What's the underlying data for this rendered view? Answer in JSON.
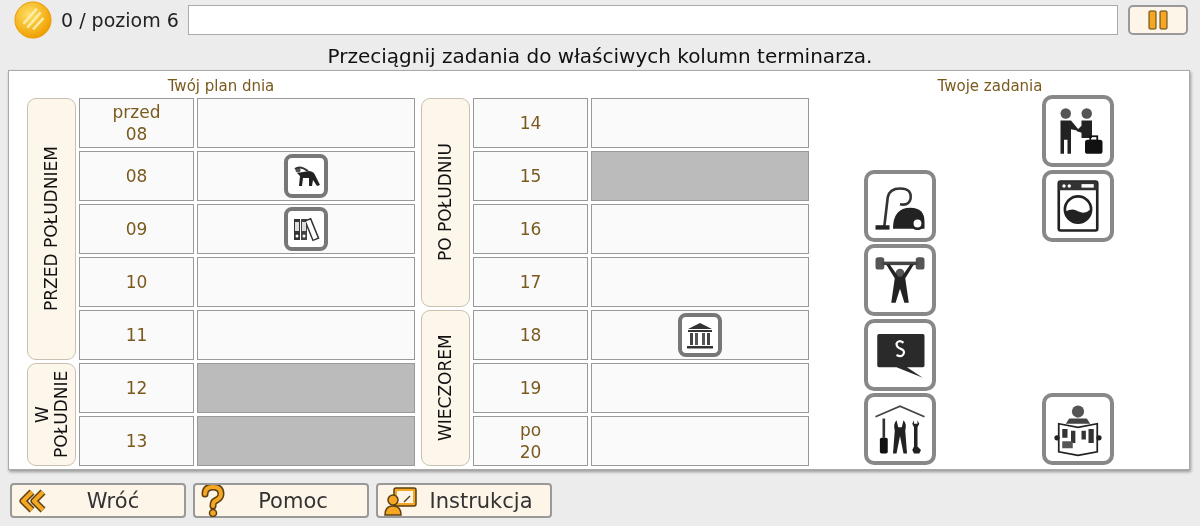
{
  "header": {
    "score": "0 / poziom 6"
  },
  "instruction": "Przeciągnij zadania do właściwych kolumn terminarza.",
  "schedule": {
    "title": "Twój plan dnia",
    "columns": [
      {
        "periods": [
          {
            "label": "PRZED POŁUDNIEM",
            "hours": [
              {
                "label": "przed\n08",
                "blocked": false
              },
              {
                "label": "08",
                "blocked": false,
                "task": {
                  "kind": "stretching"
                }
              },
              {
                "label": "09",
                "blocked": false,
                "task": {
                  "kind": "binders"
                }
              },
              {
                "label": "10",
                "blocked": false
              },
              {
                "label": "11",
                "blocked": false
              }
            ]
          },
          {
            "label": "W\nPOŁUDNIE",
            "hours": [
              {
                "label": "12",
                "blocked": true
              },
              {
                "label": "13",
                "blocked": true
              }
            ]
          }
        ]
      },
      {
        "periods": [
          {
            "label": "PO POŁUDNIU",
            "hours": [
              {
                "label": "14",
                "blocked": false
              },
              {
                "label": "15",
                "blocked": true
              },
              {
                "label": "16",
                "blocked": false
              },
              {
                "label": "17",
                "blocked": false
              }
            ]
          },
          {
            "label": "WIECZOREM",
            "hours": [
              {
                "label": "18",
                "blocked": false,
                "task": {
                  "kind": "museum"
                }
              },
              {
                "label": "19",
                "blocked": false
              },
              {
                "label": "po\n20",
                "blocked": false
              }
            ]
          }
        ]
      }
    ]
  },
  "tasks": {
    "title": "Twoje zadania",
    "columns": [
      {
        "bottom": [
          {
            "kind": "vacuum"
          },
          {
            "kind": "weightlifter"
          },
          {
            "kind": "legal"
          },
          {
            "kind": "tools"
          }
        ]
      },
      {
        "top": [
          {
            "kind": "handshake"
          },
          {
            "kind": "washer"
          }
        ],
        "bottom": [
          {
            "kind": "newspaper"
          }
        ]
      }
    ]
  },
  "buttons": [
    {
      "kind": "back",
      "label": "Wróć"
    },
    {
      "kind": "help",
      "label": "Pomoc"
    },
    {
      "kind": "instructions",
      "label": "Instrukcja"
    }
  ]
}
